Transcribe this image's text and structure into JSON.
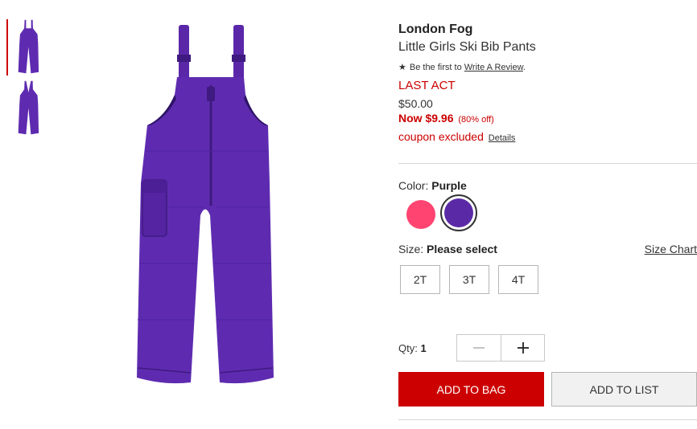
{
  "product": {
    "brand": "London Fog",
    "title": "Little Girls Ski Bib Pants",
    "review_prefix": "Be the first to",
    "review_link": "Write A Review",
    "review_suffix": ".",
    "promo": "LAST ACT",
    "original_price": "$50.00",
    "sale_price": "Now $9.96",
    "discount": "(80% off)",
    "coupon": "coupon excluded",
    "details_link": "Details"
  },
  "color": {
    "label": "Color:",
    "selected": "Purple",
    "swatches": [
      {
        "name": "Pink",
        "hex": "#ff4472"
      },
      {
        "name": "Purple",
        "hex": "#5a2aa6"
      }
    ]
  },
  "size": {
    "label": "Size:",
    "selected": "Please select",
    "chart_link": "Size Chart",
    "options": [
      "2T",
      "3T",
      "4T"
    ]
  },
  "quantity": {
    "label": "Qty:",
    "value": "1"
  },
  "actions": {
    "add_to_bag": "ADD TO BAG",
    "add_to_list": "ADD TO LIST"
  },
  "colors": {
    "accent": "#cc0000",
    "product": "#5e2bb0"
  },
  "icons": {
    "star": "star-icon",
    "minus": "minus-icon",
    "plus": "plus-icon"
  }
}
